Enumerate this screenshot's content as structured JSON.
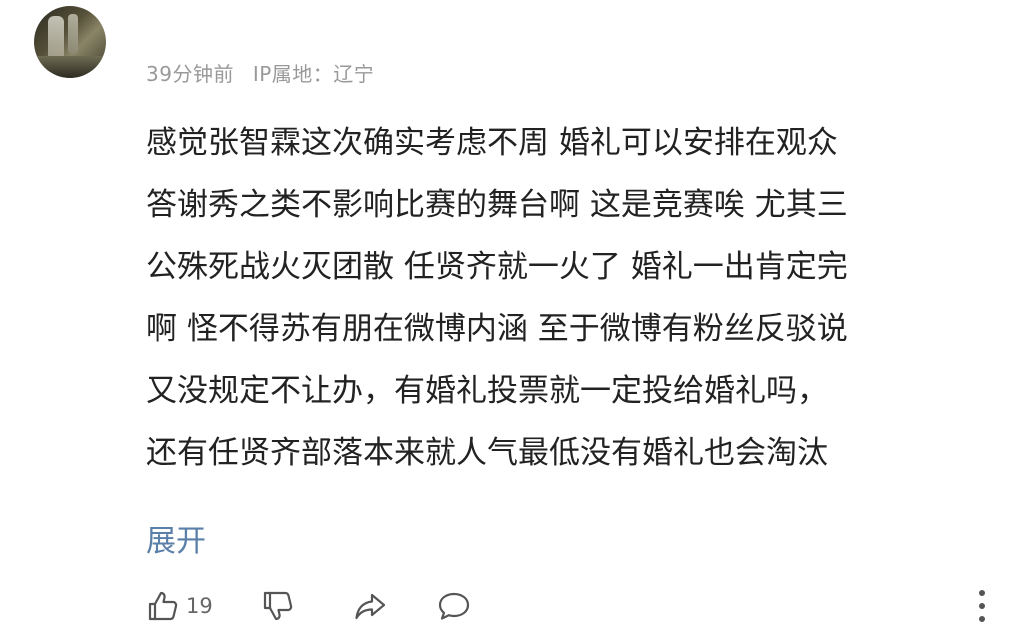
{
  "comment": {
    "time": "39分钟前",
    "ip_location": "IP属地：辽宁",
    "lines": [
      "感觉张智霖这次确实考虑不周 婚礼可以安排在观众",
      "答谢秀之类不影响比赛的舞台啊 这是竞赛唉 尤其三",
      "公殊死战火灭团散 任贤齐就一火了 婚礼一出肯定完",
      "啊 怪不得苏有朋在微博内涵 至于微博有粉丝反驳说",
      "又没规定不让办，有婚礼投票就一定投给婚礼吗，",
      "还有任贤齐部落本来就人气最低没有婚礼也会淘汰"
    ],
    "expand_label": "展开",
    "like_count": "19"
  },
  "icons": {
    "like": "thumbs-up-icon",
    "dislike": "thumbs-down-icon",
    "share": "share-icon",
    "reply": "comment-bubble-icon",
    "more": "more-vertical-icon"
  },
  "colors": {
    "link": "#5a7fa8",
    "meta": "#999999",
    "text": "#222222"
  }
}
